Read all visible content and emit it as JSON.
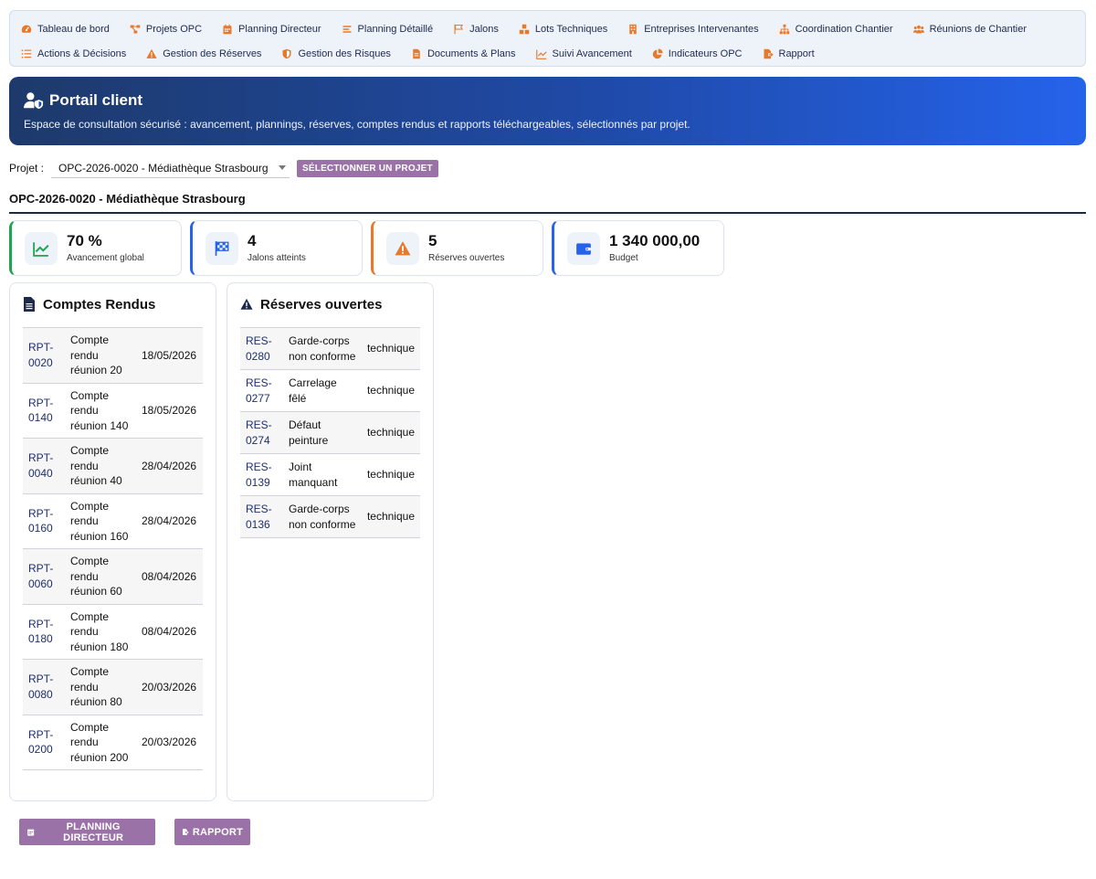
{
  "nav": {
    "row1": [
      {
        "label": "Tableau de bord",
        "icon": "gauge-icon"
      },
      {
        "label": "Projets OPC",
        "icon": "project-diagram-icon"
      },
      {
        "label": "Planning Directeur",
        "icon": "calendar-icon"
      },
      {
        "label": "Planning Détaillé",
        "icon": "bars-icon"
      },
      {
        "label": "Jalons",
        "icon": "flag-icon"
      },
      {
        "label": "Lots Techniques",
        "icon": "cubes-icon"
      },
      {
        "label": "Entreprises Intervenantes",
        "icon": "building-icon"
      },
      {
        "label": "Coordination Chantier",
        "icon": "sitemap-icon"
      },
      {
        "label": "Réunions de Chantier",
        "icon": "users-icon"
      }
    ],
    "row2": [
      {
        "label": "Actions & Décisions",
        "icon": "list-check-icon"
      },
      {
        "label": "Gestion des Réserves",
        "icon": "warning-icon"
      },
      {
        "label": "Gestion des Risques",
        "icon": "shield-icon"
      },
      {
        "label": "Documents & Plans",
        "icon": "file-icon"
      },
      {
        "label": "Suivi Avancement",
        "icon": "chart-line-icon"
      },
      {
        "label": "Indicateurs OPC",
        "icon": "pie-chart-icon"
      },
      {
        "label": "Rapport",
        "icon": "file-export-icon"
      }
    ],
    "icon_color": "#e8792b"
  },
  "banner": {
    "title": "Portail client",
    "subtitle": "Espace de consultation sécurisé : avancement, plannings, réserves, comptes rendus et rapports téléchargeables, sélectionnés par projet.",
    "icon": "user-shield-icon"
  },
  "project_selector": {
    "label": "Projet :",
    "selected": "OPC-2026-0020 - Médiathèque Strasbourg",
    "button_label": "SÉLECTIONNER UN PROJET"
  },
  "project_heading": "OPC-2026-0020 - Médiathèque Strasbourg",
  "kpis": [
    {
      "value": "70 %",
      "label": "Avancement global",
      "icon": "chart-line-icon",
      "accent": "#22a352"
    },
    {
      "value": "4",
      "label": "Jalons atteints",
      "icon": "flag-checkered-icon",
      "accent": "#2563eb"
    },
    {
      "value": "5",
      "label": "Réserves ouvertes",
      "icon": "warning-icon",
      "accent": "#e8792b"
    },
    {
      "value": "1 340 000,00",
      "label": "Budget",
      "icon": "wallet-icon",
      "accent": "#2563eb"
    }
  ],
  "comptes_rendus": {
    "title": "Comptes Rendus",
    "rows": [
      {
        "code": "RPT-0020",
        "title": "Compte rendu réunion 20",
        "date": "18/05/2026"
      },
      {
        "code": "RPT-0140",
        "title": "Compte rendu réunion 140",
        "date": "18/05/2026"
      },
      {
        "code": "RPT-0040",
        "title": "Compte rendu réunion 40",
        "date": "28/04/2026"
      },
      {
        "code": "RPT-0160",
        "title": "Compte rendu réunion 160",
        "date": "28/04/2026"
      },
      {
        "code": "RPT-0060",
        "title": "Compte rendu réunion 60",
        "date": "08/04/2026"
      },
      {
        "code": "RPT-0180",
        "title": "Compte rendu réunion 180",
        "date": "08/04/2026"
      },
      {
        "code": "RPT-0080",
        "title": "Compte rendu réunion 80",
        "date": "20/03/2026"
      },
      {
        "code": "RPT-0200",
        "title": "Compte rendu réunion 200",
        "date": "20/03/2026"
      }
    ]
  },
  "reserves": {
    "title": "Réserves ouvertes",
    "rows": [
      {
        "code": "RES-0280",
        "title": "Garde-corps non conforme",
        "type": "technique"
      },
      {
        "code": "RES-0277",
        "title": "Carrelage fêlé",
        "type": "technique"
      },
      {
        "code": "RES-0274",
        "title": "Défaut peinture",
        "type": "technique"
      },
      {
        "code": "RES-0139",
        "title": "Joint manquant",
        "type": "technique"
      },
      {
        "code": "RES-0136",
        "title": "Garde-corps non conforme",
        "type": "technique"
      }
    ]
  },
  "actions": {
    "planning_label": "PLANNING DIRECTEUR",
    "rapport_label": "RAPPORT"
  }
}
